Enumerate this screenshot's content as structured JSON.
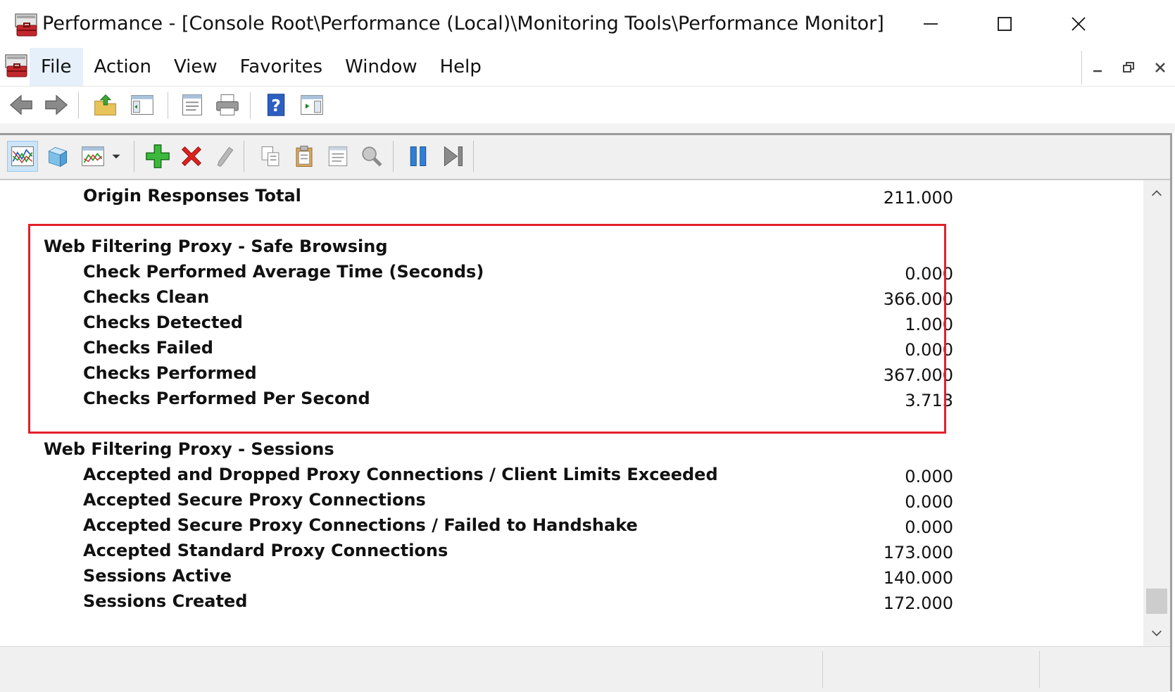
{
  "window": {
    "title": "Performance - [Console Root\\Performance (Local)\\Monitoring Tools\\Performance Monitor]"
  },
  "menu": {
    "items": [
      {
        "label": "File"
      },
      {
        "label": "Action"
      },
      {
        "label": "View"
      },
      {
        "label": "Favorites"
      },
      {
        "label": "Window"
      },
      {
        "label": "Help"
      }
    ]
  },
  "toolbar": {
    "icons": [
      "back-icon",
      "forward-icon",
      "up-folder-icon",
      "show-hide-tree-icon",
      "properties-icon",
      "print-icon",
      "help-icon",
      "show-hide-action-pane-icon"
    ]
  },
  "perfmon_toolbar": {
    "icons": [
      "view-current-activity-icon",
      "view-log-data-icon",
      "change-graph-type-icon",
      "dropdown-arrow-icon",
      "add-counter-icon",
      "delete-counter-icon",
      "highlight-icon",
      "copy-properties-icon",
      "paste-counter-list-icon",
      "properties-icon",
      "zoom-icon",
      "freeze-display-icon",
      "update-data-icon"
    ]
  },
  "report": {
    "rows": [
      {
        "type": "counter",
        "label": "Origin Responses Total",
        "value": "211.000"
      },
      {
        "type": "category",
        "label": "Web Filtering Proxy - Safe Browsing"
      },
      {
        "type": "counter",
        "label": "Check Performed Average Time (Seconds)",
        "value": "0.000"
      },
      {
        "type": "counter",
        "label": "Checks Clean",
        "value": "366.000"
      },
      {
        "type": "counter",
        "label": "Checks Detected",
        "value": "1.000"
      },
      {
        "type": "counter",
        "label": "Checks Failed",
        "value": "0.000"
      },
      {
        "type": "counter",
        "label": "Checks Performed",
        "value": "367.000"
      },
      {
        "type": "counter",
        "label": "Checks Performed Per Second",
        "value": "3.713"
      },
      {
        "type": "category",
        "label": "Web Filtering Proxy - Sessions"
      },
      {
        "type": "counter",
        "label": "Accepted and Dropped Proxy Connections / Client Limits Exceeded",
        "value": "0.000"
      },
      {
        "type": "counter",
        "label": "Accepted Secure Proxy Connections",
        "value": "0.000"
      },
      {
        "type": "counter",
        "label": "Accepted Secure Proxy Connections / Failed to Handshake",
        "value": "0.000"
      },
      {
        "type": "counter",
        "label": "Accepted Standard Proxy Connections",
        "value": "173.000"
      },
      {
        "type": "counter",
        "label": "Sessions Active",
        "value": "140.000"
      },
      {
        "type": "counter",
        "label": "Sessions Created",
        "value": "172.000"
      }
    ]
  },
  "colors": {
    "highlight_border": "#e3202a",
    "toolbar_bg": "#f0f0f0"
  }
}
